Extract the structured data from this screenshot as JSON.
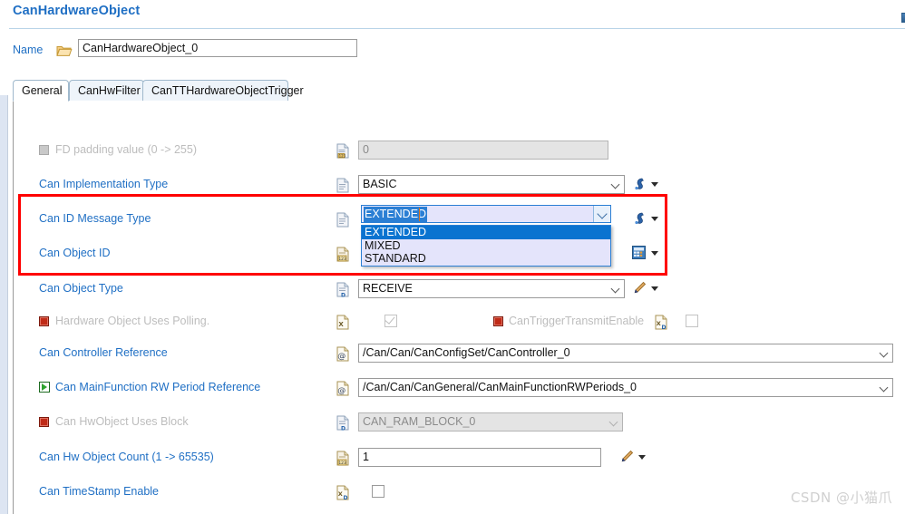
{
  "header": {
    "title": "CanHardwareObject",
    "corner_icon": "panel-edge-icon"
  },
  "name_row": {
    "label": "Name",
    "folder_icon": "folder-icon",
    "value": "CanHardwareObject_0",
    "placeholder": "CanHardwareObject_0"
  },
  "tabs": [
    {
      "label": "General",
      "active": true
    },
    {
      "label": "CanHwFilter",
      "active": false
    },
    {
      "label": "CanTTHardwareObjectTrigger",
      "active": false
    }
  ],
  "rows": [
    {
      "label": "FD padding value (0 -> 255)",
      "value": "0",
      "left_icon": "gray-square-icon",
      "value_icon": "numeric-document-icon",
      "disabled": true
    },
    {
      "label": "Can Implementation Type",
      "value": "BASIC",
      "value_icon": "document-icon",
      "tool_icon": "swirl-icon",
      "disabled": false
    },
    {
      "label": "Can ID Message Type",
      "value": "EXTENDED",
      "value_icon": "document-icon",
      "tool_icon": "swirl-icon",
      "disabled": false
    },
    {
      "label": "Can Object ID",
      "value": "",
      "value_icon": "numeric-document-icon",
      "tool_icon": "calculator-icon",
      "disabled": false
    },
    {
      "label": "Can Object Type",
      "value": "RECEIVE",
      "value_icon": "document-default-icon",
      "tool_icon": "pencil-icon",
      "disabled": false
    },
    {
      "label": "Hardware Object Uses Polling.",
      "left_icon": "red-square-icon",
      "value_icon": "xml-document-icon",
      "checked": true,
      "disabled": true,
      "extra_label": "CanTriggerTransmitEnable",
      "extra_left_icon": "red-square-icon",
      "extra_value_icon": "xml-document-icon",
      "extra_checked": false
    },
    {
      "label": "Can Controller Reference",
      "value": "/Can/Can/CanConfigSet/CanController_0",
      "value_icon": "at-document-icon",
      "disabled": false
    },
    {
      "label": "Can MainFunction RW Period Reference",
      "value": "/Can/Can/CanGeneral/CanMainFunctionRWPeriods_0",
      "left_icon": "green-play-icon",
      "value_icon": "at-document-icon",
      "disabled": false
    },
    {
      "label": "Can HwObject Uses Block",
      "value": "CAN_RAM_BLOCK_0",
      "left_icon": "red-square-icon",
      "value_icon": "document-default-icon",
      "disabled": true
    },
    {
      "label": "Can Hw Object Count (1 -> 65535)",
      "value": "1",
      "value_icon": "numeric-document-icon",
      "tool_icon": "pencil-icon",
      "disabled": false
    },
    {
      "label": "Can TimeStamp Enable",
      "value_icon": "xml-document-icon",
      "checked": false,
      "disabled": false
    }
  ],
  "dropdown": {
    "selected": "EXTENDED",
    "options": [
      "EXTENDED",
      "MIXED",
      "STANDARD"
    ],
    "highlighted_index": 0
  },
  "highlight_box": {
    "color": "#ff0000"
  },
  "watermark": {
    "text": "CSDN @小猫爪"
  },
  "colors": {
    "label_blue": "#1f6fc4",
    "title_blue": "#1f6fc4",
    "selection_blue": "#2b7fd4",
    "list_bg": "#e4e4fb",
    "highlight_red": "#ff0000"
  }
}
